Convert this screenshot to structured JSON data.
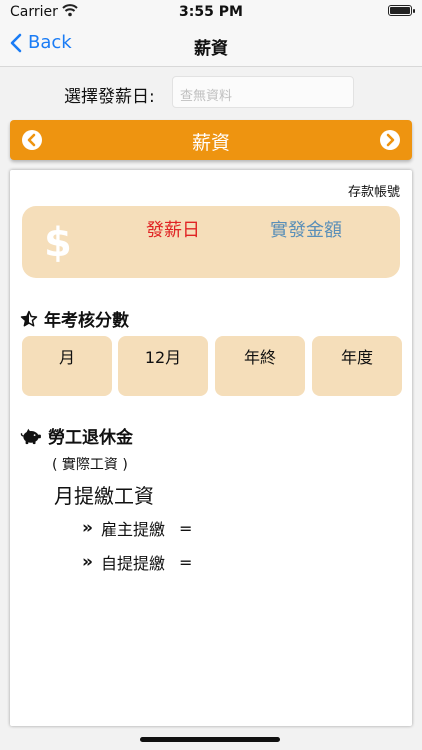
{
  "status_bar": {
    "carrier": "Carrier",
    "time": "3:55 PM"
  },
  "nav": {
    "back_label": "Back",
    "title": "薪資"
  },
  "picker": {
    "label": "選擇發薪日:",
    "placeholder": "查無資料"
  },
  "header": {
    "title": "薪資"
  },
  "card": {
    "account_label": "存款帳號",
    "salary": {
      "currency_symbol": "$",
      "payday_label": "發薪日",
      "net_pay_label": "實發金額"
    },
    "evaluation": {
      "title": "年考核分數",
      "cells": [
        "月",
        "12月",
        "年終",
        "年度"
      ]
    },
    "pension": {
      "title": "勞工退休金",
      "actual_wage_label": "( 實際工資 )",
      "monthly_label": "月提繳工資",
      "employer_label": "雇主提繳",
      "self_label": "自提提繳",
      "equals": "="
    }
  },
  "colors": {
    "accent_orange": "#ee9410",
    "cell_bg": "#f5deba",
    "payday_red": "#e02424",
    "net_pay_blue": "#5a8fb8",
    "link_blue": "#1a7cf5"
  }
}
